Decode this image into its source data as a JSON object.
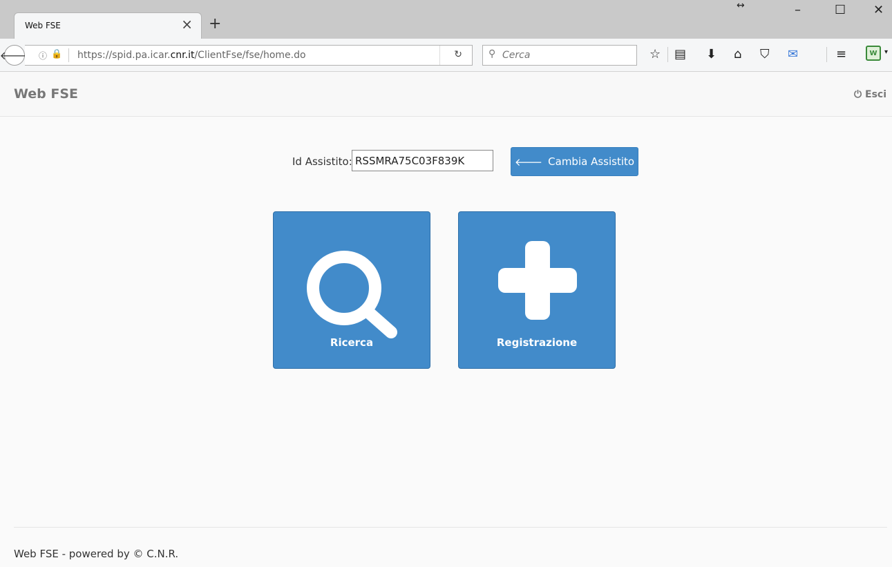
{
  "browser": {
    "tab_title": "Web FSE",
    "tab_close": "×",
    "new_tab": "+",
    "url_prefix": "https://spid.pa.icar.",
    "url_domain": "cnr.it",
    "url_suffix": "/ClientFse/fse/home.do",
    "search_placeholder": "Cerca"
  },
  "app": {
    "brand": "Web FSE",
    "logout_label": "Esci",
    "id_label": "Id Assistito:",
    "id_value": "RSSMRA75C03F839K",
    "change_button": "Cambia Assistito",
    "tiles": [
      {
        "label": "Ricerca",
        "icon": "search-icon"
      },
      {
        "label": "Registrazione",
        "icon": "plus-icon"
      }
    ],
    "footer": "Web FSE - powered by © C.N.R."
  },
  "colors": {
    "primary": "#428bca",
    "brand_text": "#777777"
  }
}
